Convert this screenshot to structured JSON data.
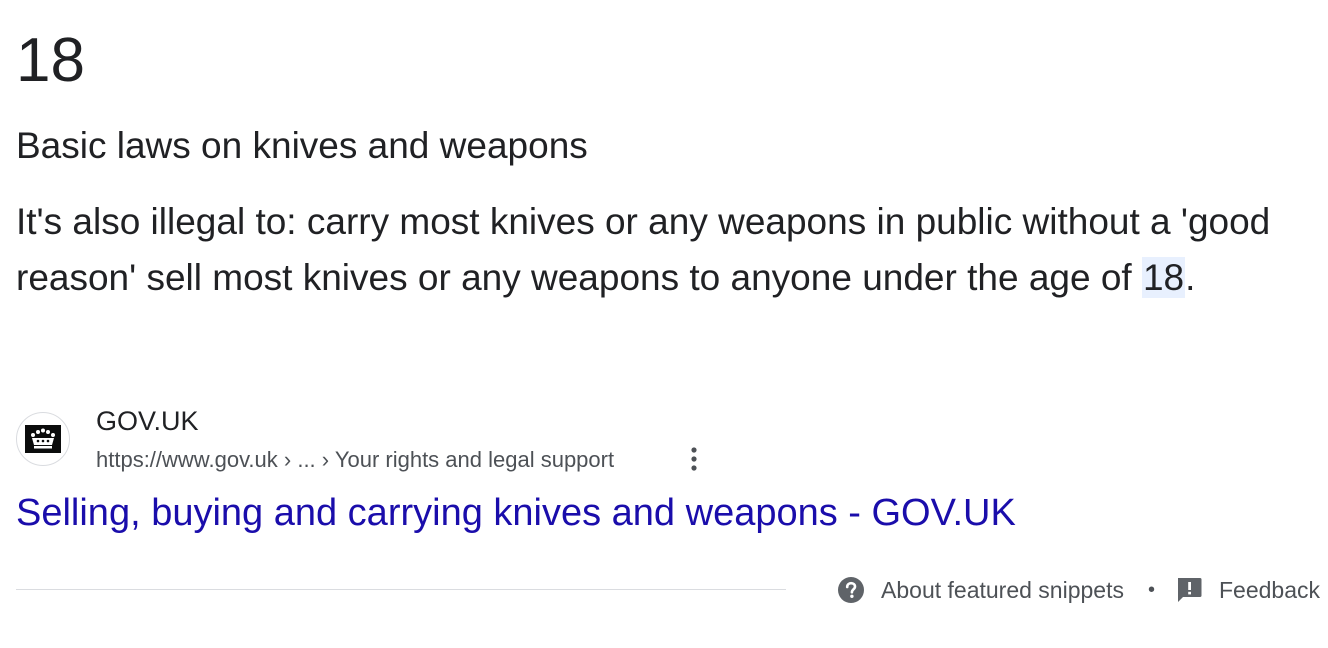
{
  "answer": {
    "value": "18",
    "subtitle": "Basic laws on knives and weapons"
  },
  "snippet": {
    "text_before": "It's also illegal to: carry most knives or any weapons in public without a 'good reason' sell most knives or any weapons to anyone under the age of ",
    "highlight": "18",
    "text_after": "."
  },
  "source": {
    "site_name": "GOV.UK",
    "url_display": "https://www.gov.uk › ... › Your rights and legal support",
    "favicon_icon": "crown-icon",
    "more_icon": "vertical-dots-icon"
  },
  "result": {
    "title": "Selling, buying and carrying knives and weapons - GOV.UK"
  },
  "footer": {
    "about_label": "About featured snippets",
    "about_icon": "question-circle-icon",
    "separator": "•",
    "feedback_label": "Feedback",
    "feedback_icon": "feedback-icon"
  },
  "colors": {
    "link": "#1a0dab",
    "text": "#202124",
    "muted": "#4d5156",
    "highlight": "#e8f0fe",
    "icon": "#5f6368"
  }
}
